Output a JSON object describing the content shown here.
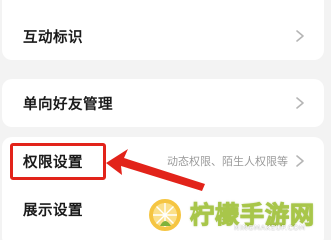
{
  "settings_list": {
    "items": [
      {
        "label": "互动标识",
        "subtext": ""
      },
      {
        "label": "单向好友管理",
        "subtext": ""
      },
      {
        "label": "权限设置",
        "subtext": "动态权限、陌生人权限等"
      },
      {
        "label": "展示设置",
        "subtext": ""
      }
    ]
  },
  "annotation": {
    "highlight_color": "#e2231a",
    "arrow_color": "#e2231a"
  },
  "watermark": {
    "title": "柠檬手游网",
    "url": "NINGMAKEUP.COM"
  },
  "colors": {
    "background": "#f3f3f3",
    "card": "#ffffff",
    "label": "#1a1a1a",
    "subtext": "#9a9a9a",
    "chevron": "#b5b5b5"
  }
}
